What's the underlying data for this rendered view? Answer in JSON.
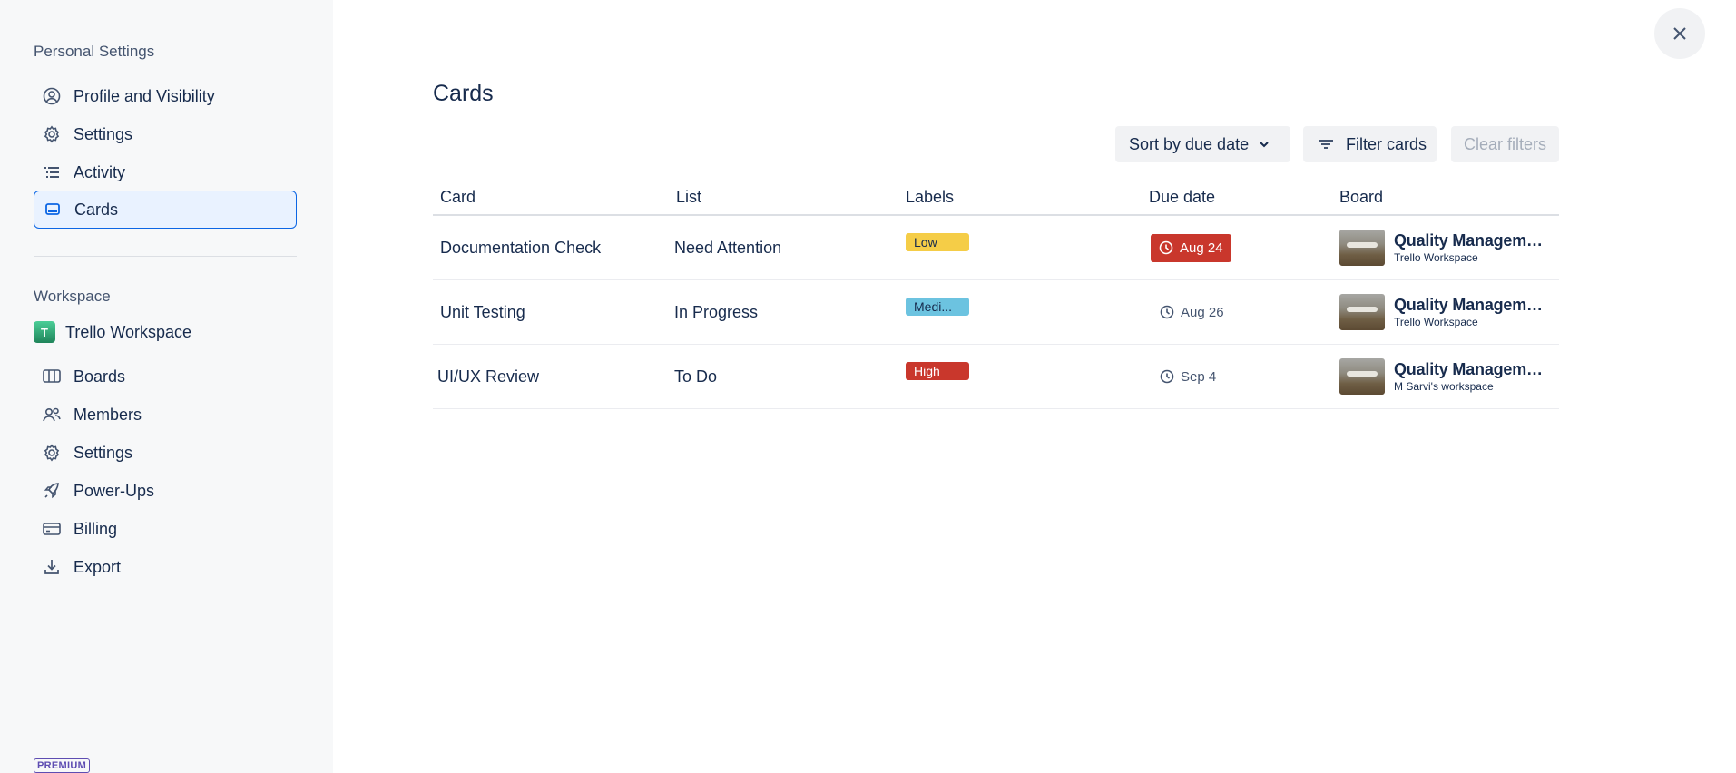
{
  "sidebar": {
    "personal_title": "Personal Settings",
    "personal_items": [
      {
        "label": "Profile and Visibility",
        "icon": "profile-icon"
      },
      {
        "label": "Settings",
        "icon": "gear-icon"
      },
      {
        "label": "Activity",
        "icon": "activity-list-icon"
      },
      {
        "label": "Cards",
        "icon": "card-icon",
        "active": true
      }
    ],
    "workspace_title": "Workspace",
    "workspace_name": "Trello Workspace",
    "workspace_avatar_letter": "T",
    "workspace_items": [
      {
        "label": "Boards",
        "icon": "boards-icon"
      },
      {
        "label": "Members",
        "icon": "members-icon"
      },
      {
        "label": "Settings",
        "icon": "gear-icon"
      },
      {
        "label": "Power-Ups",
        "icon": "rocket-icon"
      },
      {
        "label": "Billing",
        "icon": "credit-card-icon"
      },
      {
        "label": "Export",
        "icon": "download-icon"
      }
    ],
    "premium_badge": "PREMIUM"
  },
  "main": {
    "title": "Cards",
    "sort_label": "Sort by due date",
    "filter_label": "Filter cards",
    "clear_label": "Clear filters",
    "columns": [
      "Card",
      "List",
      "Labels",
      "Due date",
      "Board"
    ],
    "rows": [
      {
        "card": "Documentation Check",
        "list": "Need Attention",
        "label": "Low",
        "label_color": "#f5cd47",
        "due": "Aug 24",
        "overdue": true,
        "board": "Quality Manageme...",
        "workspace": "Trello Workspace"
      },
      {
        "card": "Unit Testing",
        "list": "In Progress",
        "label": "Medi...",
        "label_color": "#6cc3e0",
        "due": "Aug 26",
        "overdue": false,
        "board": "Quality Manageme...",
        "workspace": "Trello Workspace"
      },
      {
        "card": "UI/UX Review",
        "list": "To Do",
        "label": "High",
        "label_color": "#c9372c",
        "due": "Sep 4",
        "overdue": false,
        "board": "Quality Manageme...",
        "workspace": "M Sarvi's workspace"
      }
    ]
  },
  "colors": {
    "accent": "#0c66e4",
    "overdue": "#c9372c",
    "sidebar_bg": "#f7f8f9"
  }
}
